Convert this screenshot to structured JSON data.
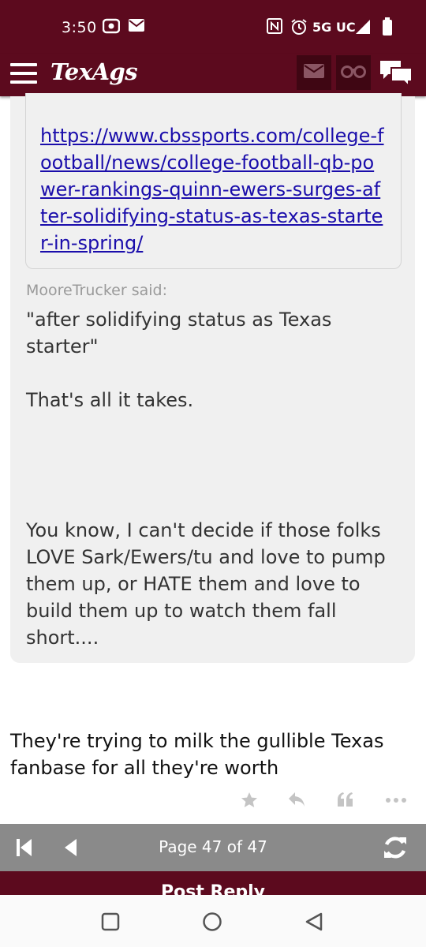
{
  "status_bar": {
    "time": "3:50",
    "network": "5G UC",
    "icons": [
      "screen-record-icon",
      "mail-icon",
      "nfc-icon",
      "alarm-icon",
      "signal-icon",
      "battery-icon"
    ]
  },
  "header": {
    "logo": "TexAgs",
    "icons": [
      "menu-icon",
      "mail-icon",
      "binoculars-icon",
      "chat-icon"
    ]
  },
  "quote": {
    "link": "https://www.cbssports.com/college-football/news/college-football-qb-power-rankings-quinn-ewers-surges-after-solidifying-status-as-texas-starter-in-spring/",
    "author_said": "MooreTrucker said:",
    "quoted_text": "\"after solidifying status as Texas starter\"\n\nThat's all it takes.",
    "reply_text": "You know, I can't decide if those folks LOVE Sark/Ewers/tu and love to pump them up, or HATE them and love to build them up to watch them fall short...."
  },
  "post": {
    "body": "They're trying to milk the gullible Texas fanbase for all they're worth",
    "actions": [
      "star-icon",
      "reply-icon",
      "quote-icon",
      "more-icon"
    ]
  },
  "pager": {
    "label": "Page 47 of 47"
  },
  "post_reply": {
    "label": "Post Reply"
  },
  "colors": {
    "brand": "#5c0a1e",
    "link": "#1a0dab",
    "pager": "#8a8a8a"
  }
}
